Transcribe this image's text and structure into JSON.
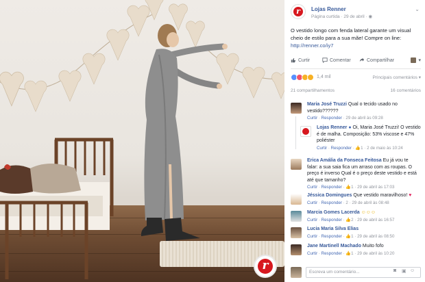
{
  "post": {
    "page_name": "Lojas Renner",
    "meta": "Página curtida · 29 de abril ·",
    "text": "O vestido longo com fenda lateral garante um visual cheio de estilo para a sua mãe! Compre on line:",
    "link": "http://renner.co/iy7"
  },
  "actions": {
    "like": "Curtir",
    "comment": "Comentar",
    "share": "Compartilhar"
  },
  "reactions": {
    "count": "1,4 mil",
    "sort": "Principais comentários"
  },
  "shares": {
    "shares": "21 compartilhamentos",
    "comments": "16 comentários"
  },
  "comments": [
    {
      "name": "Maria José Truzzi",
      "text": "Qual o tecido usado no vestido??????",
      "like": "Curtir",
      "reply": "Responder",
      "time": "29 de abril às 09:28",
      "likes": "",
      "reply_count": ""
    },
    {
      "name": "Lojas Renner",
      "text": "Oi, Maria José Truzzi! O vestido é de malha. Composição: 53% viscose e 47% poliéster",
      "like": "Curtir",
      "reply": "Responder",
      "time": "2 de maio às 10:24",
      "likes": "1",
      "reply_count": ""
    },
    {
      "name": "Erica Amália da Fonseca Feitosa",
      "text": "Eu já vou te falar: a sua saia fica um arraso com as roupas. O preço é inverso Qual é o preço deste vestido e está até que tamanho?",
      "like": "Curtir",
      "reply": "Responder",
      "time": "29 de abril às 17:03",
      "likes": "1",
      "reply_count": ""
    },
    {
      "name": "Jéssica Domingues",
      "text": "Que vestido maravilhoso!",
      "like": "Curtir",
      "reply": "Responder",
      "time": "29 de abril às 08:48",
      "likes": "",
      "reply_count": "2"
    },
    {
      "name": "Marcia Gomes Lacerda",
      "text": "",
      "like": "Curtir",
      "reply": "Responder",
      "time": "29 de abril às 16:57",
      "likes": "2",
      "reply_count": ""
    },
    {
      "name": "Lucia Maria Silva Elias",
      "text": "",
      "like": "Curtir",
      "reply": "Responder",
      "time": "29 de abril às 08:50",
      "likes": "1",
      "reply_count": ""
    },
    {
      "name": "Jane Martinell Machado",
      "text": "Muito fofo",
      "like": "Curtir",
      "reply": "Responder",
      "time": "29 de abril às 10:20",
      "likes": "1",
      "reply_count": ""
    }
  ],
  "compose": {
    "placeholder": "Escreva um comentário..."
  },
  "colors": {
    "brand_red": "#d7181f",
    "fb_link": "#365899",
    "meta_gray": "#90949c"
  }
}
